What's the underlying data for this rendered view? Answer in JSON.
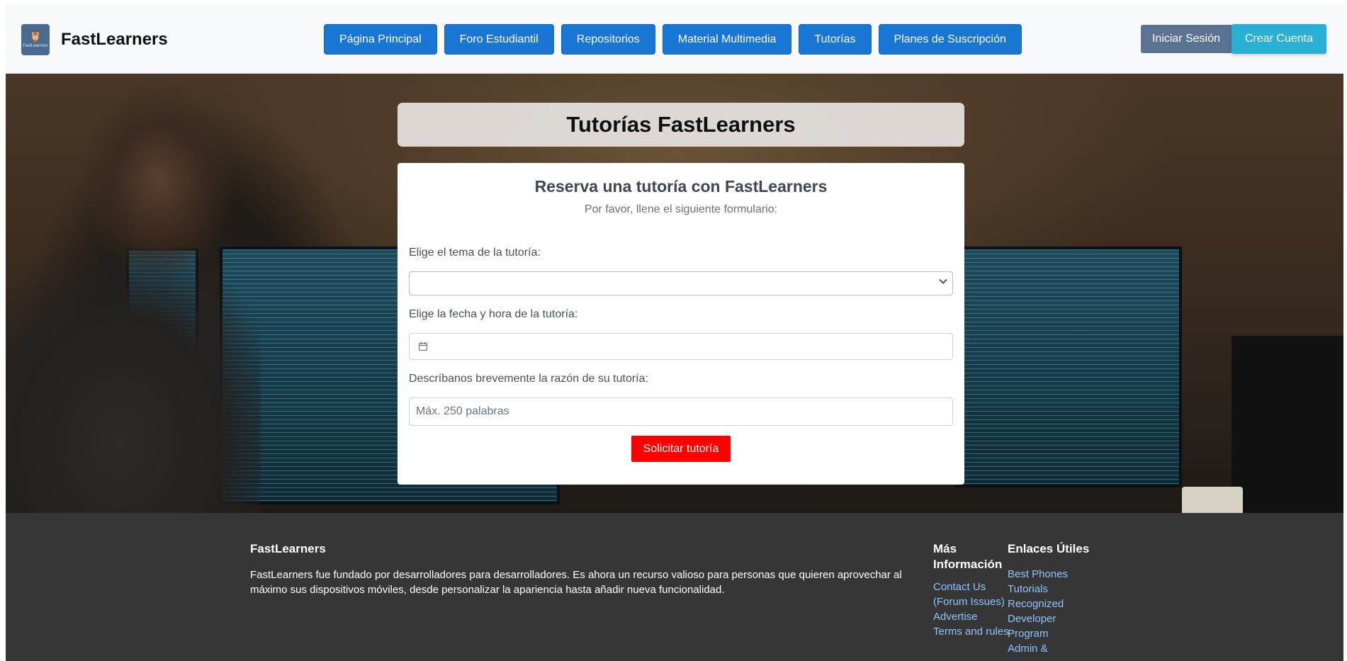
{
  "header": {
    "brand_name": "FastLearners",
    "logo_text": "FastLearners",
    "nav": [
      {
        "label": "Página Principal"
      },
      {
        "label": "Foro Estudiantil"
      },
      {
        "label": "Repositorios"
      },
      {
        "label": "Material Multimedia"
      },
      {
        "label": "Tutorías"
      },
      {
        "label": "Planes de Suscripción"
      }
    ],
    "login_label": "Iniciar Sesión",
    "register_label": "Crear Cuenta"
  },
  "hero": {
    "page_title": "Tutorías FastLearners"
  },
  "form": {
    "heading": "Reserva una tutoría con FastLearners",
    "subheading": "Por favor, llene el siguiente formulario:",
    "topic_label": "Elige el tema de la tutoría:",
    "topic_value": "",
    "date_label": "Elige la fecha y hora de la tutoría:",
    "date_value": "",
    "reason_label": "Descríbanos brevemente la razón de su tutoría:",
    "reason_placeholder": "Máx. 250 palabras",
    "submit_label": "Solicitar tutoría"
  },
  "footer": {
    "about_title": "FastLearners",
    "about_text": "FastLearners fue fundado por desarrolladores para desarrolladores. Es ahora un recurso valioso para personas que quieren aprovechar al máximo sus dispositivos móviles, desde personalizar la apariencia hasta añadir nueva funcionalidad.",
    "more_title": "Más Información",
    "more_links": [
      {
        "label": "Contact Us (Forum Issues)"
      },
      {
        "label": "Advertise"
      },
      {
        "label": "Terms and rules"
      }
    ],
    "useful_title": "Enlaces Útiles",
    "useful_links": [
      {
        "label": "Best Phones"
      },
      {
        "label": "Tutorials"
      },
      {
        "label": "Recognized Developer Program"
      },
      {
        "label": "Admin &"
      }
    ]
  },
  "colors": {
    "nav_button": "#1976d2",
    "login_button": "#5a7393",
    "register_button": "#2ab0d4",
    "submit_button": "#ff0000",
    "footer_bg": "#363636",
    "footer_link": "#8ec5ff"
  },
  "icons": {
    "logo": "owl-logo-icon",
    "select_chevron": "chevron-down-icon",
    "date": "calendar-icon"
  }
}
